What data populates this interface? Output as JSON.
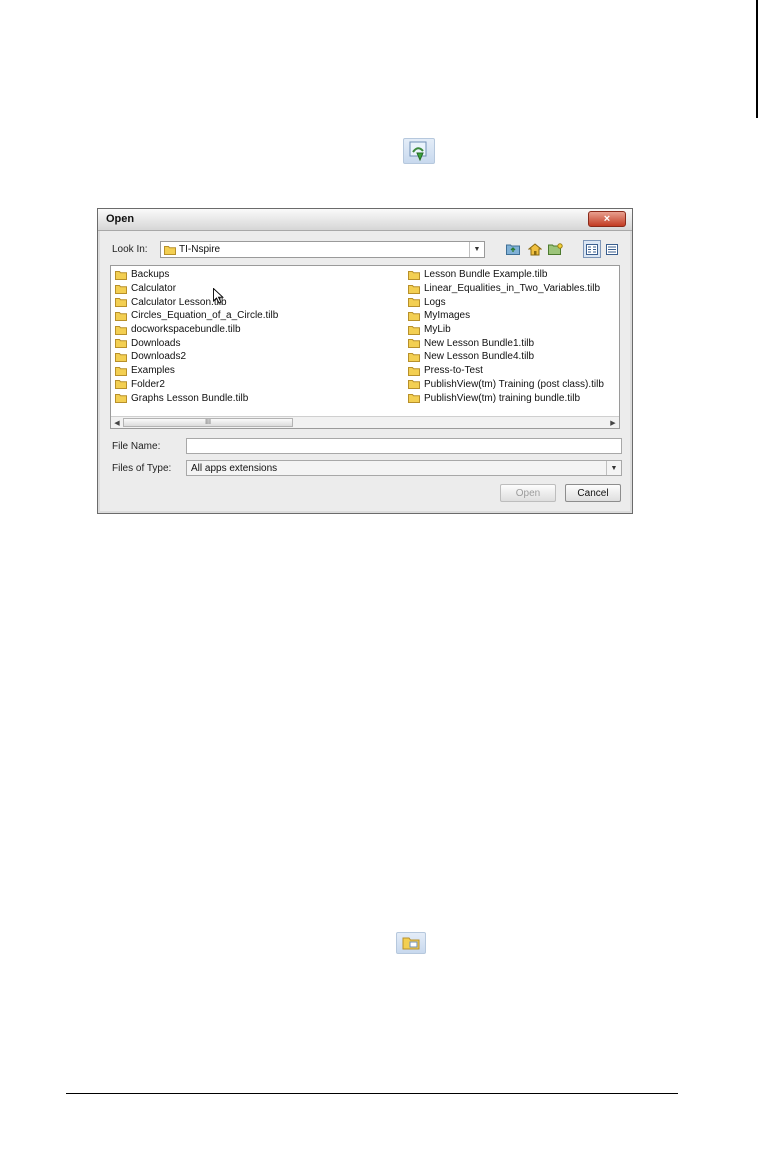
{
  "dialog": {
    "title": "Open",
    "close_label": "×",
    "look_in_label": "Look In:",
    "look_in_value": "TI-Nspire",
    "file_name_label": "File Name:",
    "file_name_value": "",
    "files_of_type_label": "Files of Type:",
    "files_of_type_value": "All apps extensions",
    "open_label": "Open",
    "cancel_label": "Cancel",
    "scroll_thumb_grip": "III"
  },
  "files": {
    "left": [
      "Backups",
      "Calculator",
      "Calculator Lesson.tilb",
      "Circles_Equation_of_a_Circle.tilb",
      "docworkspacebundle.tilb",
      "Downloads",
      "Downloads2",
      "Examples",
      "Folder2",
      "Graphs Lesson Bundle.tilb"
    ],
    "right": [
      "Lesson Bundle Example.tilb",
      "Linear_Equalities_in_Two_Variables.tilb",
      "Logs",
      "MyImages",
      "MyLib",
      "New Lesson Bundle1.tilb",
      "New Lesson Bundle4.tilb",
      "Press-to-Test",
      "PublishView(tm) Training (post class).tilb",
      "PublishView(tm) training bundle.tilb"
    ]
  },
  "colors": {
    "folder_fill": "#f3cf52",
    "folder_stroke": "#b8902a",
    "close_button": "#c23b22"
  },
  "icons": {
    "doc_icon": "open-document-icon",
    "folder_icon": "folder-icon",
    "toolbar": [
      "up-one-level-icon",
      "home-folder-icon",
      "new-folder-icon",
      "list-view-icon",
      "details-view-icon"
    ]
  }
}
